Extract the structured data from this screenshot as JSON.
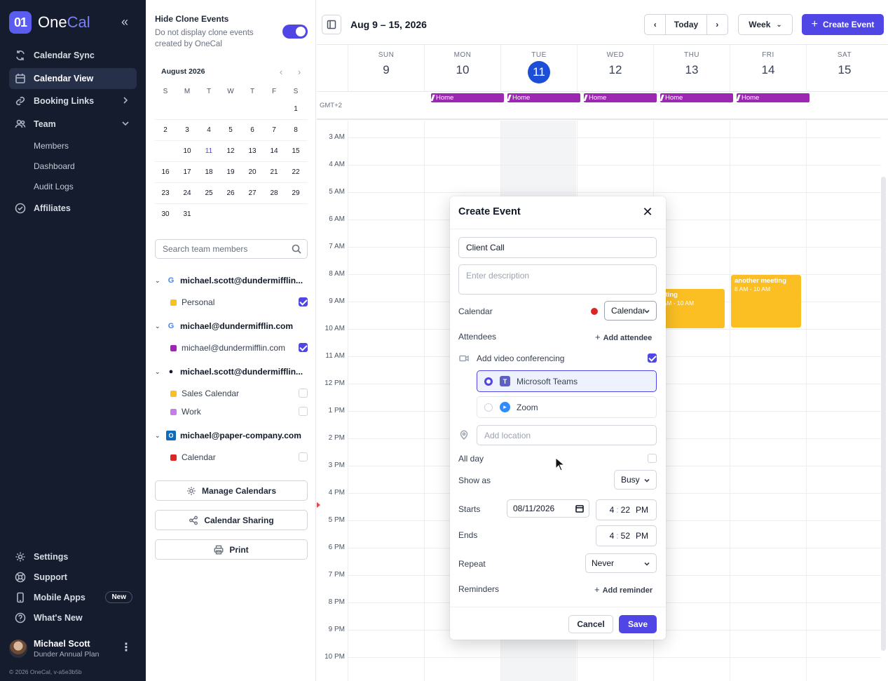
{
  "app": {
    "logo_mark": "01",
    "logo_a": "One",
    "logo_b": "Cal"
  },
  "sidebar": {
    "items": [
      {
        "label": "Calendar Sync",
        "icon": "sync-icon"
      },
      {
        "label": "Calendar View",
        "icon": "calendar-icon",
        "active": true
      },
      {
        "label": "Booking Links",
        "icon": "link-icon"
      },
      {
        "label": "Team",
        "icon": "users-icon"
      },
      {
        "label": "Affiliates",
        "icon": "check-circle-icon"
      }
    ],
    "team_sub": [
      "Members",
      "Dashboard",
      "Audit Logs"
    ],
    "bottom": [
      {
        "label": "Settings",
        "icon": "gear-icon"
      },
      {
        "label": "Support",
        "icon": "support-icon"
      },
      {
        "label": "Mobile Apps",
        "icon": "phone-icon",
        "badge": "New"
      },
      {
        "label": "What's New",
        "icon": "question-icon"
      }
    ],
    "user": {
      "name": "Michael Scott",
      "plan": "Dunder Annual Plan"
    },
    "footer": "© 2026 OneCal, v-a5e3b5b"
  },
  "panel": {
    "clone_title": "Hide Clone Events",
    "clone_desc": "Do not display clone events created by OneCal",
    "mini_cal": {
      "title": "August 2026",
      "dow": [
        "S",
        "M",
        "T",
        "W",
        "T",
        "F",
        "S"
      ],
      "weeks": [
        [
          "",
          "",
          "",
          "",
          "",
          "",
          "1"
        ],
        [
          "2",
          "3",
          "4",
          "5",
          "6",
          "7",
          "8"
        ],
        [
          "9",
          "10",
          "11",
          "12",
          "13",
          "14",
          "15"
        ],
        [
          "16",
          "17",
          "18",
          "19",
          "20",
          "21",
          "22"
        ],
        [
          "23",
          "24",
          "25",
          "26",
          "27",
          "28",
          "29"
        ],
        [
          "30",
          "31",
          "",
          "",
          "",
          "",
          ""
        ]
      ],
      "selected": "9",
      "today": "11"
    },
    "search_placeholder": "Search team members",
    "accounts": [
      {
        "email": "michael.scott@dundermifflin...",
        "provider": "google",
        "calendars": [
          {
            "name": "Personal",
            "color": "#fbbf24",
            "checked": true
          }
        ]
      },
      {
        "email": "michael@dundermifflin.com",
        "provider": "google",
        "calendars": [
          {
            "name": "michael@dundermifflin.com",
            "color": "#9c27b0",
            "checked": true
          }
        ]
      },
      {
        "email": "michael.scott@dundermifflin...",
        "provider": "apple",
        "calendars": [
          {
            "name": "Sales Calendar",
            "color": "#fbbf24",
            "checked": false
          },
          {
            "name": "Work",
            "color": "#c77de8",
            "checked": false
          }
        ]
      },
      {
        "email": "michael@paper-company.com",
        "provider": "outlook",
        "calendars": [
          {
            "name": "Calendar",
            "color": "#dc2626",
            "checked": false
          }
        ]
      }
    ],
    "buttons": {
      "manage": "Manage Calendars",
      "sharing": "Calendar Sharing",
      "print": "Print"
    }
  },
  "header": {
    "range": "Aug 9 – 15, 2026",
    "today": "Today",
    "view": "Week",
    "create": "Create Event",
    "prev": "‹",
    "next": "›"
  },
  "week": {
    "days": [
      {
        "dow": "SUN",
        "num": "9"
      },
      {
        "dow": "MON",
        "num": "10"
      },
      {
        "dow": "TUE",
        "num": "11",
        "today": true
      },
      {
        "dow": "WED",
        "num": "12"
      },
      {
        "dow": "THU",
        "num": "13"
      },
      {
        "dow": "FRI",
        "num": "14"
      },
      {
        "dow": "SAT",
        "num": "15"
      }
    ],
    "timezone": "GMT+2",
    "allday_label": "Home",
    "hours": [
      "3 AM",
      "4 AM",
      "5 AM",
      "6 AM",
      "7 AM",
      "8 AM",
      "9 AM",
      "10 AM",
      "11 AM",
      "12 PM",
      "1 PM",
      "2 PM",
      "3 PM",
      "4 PM",
      "5 PM",
      "6 PM",
      "7 PM",
      "8 PM",
      "9 PM",
      "10 PM"
    ],
    "events": [
      {
        "title": "eeting",
        "time": "0 AM - 10 AM"
      },
      {
        "title": "another meeting",
        "time": "8 AM - 10 AM"
      }
    ]
  },
  "modal": {
    "title": "Create Event",
    "close": "✕",
    "title_value": "Client Call",
    "description_placeholder": "Enter description",
    "calendar_label": "Calendar",
    "calendar_value": "Calendar",
    "calendar_color": "#dc2626",
    "attendees_label": "Attendees",
    "add_attendee": "Add attendee",
    "video_label": "Add video conferencing",
    "video_options": [
      {
        "label": "Microsoft Teams",
        "selected": true
      },
      {
        "label": "Zoom",
        "selected": false
      }
    ],
    "location_placeholder": "Add location",
    "allday_label": "All day",
    "showas_label": "Show as",
    "showas_value": "Busy",
    "starts_label": "Starts",
    "start_date": "08/11/2026",
    "start_time": {
      "h": "4",
      "m": "22",
      "ap": "PM"
    },
    "ends_label": "Ends",
    "end_time": {
      "h": "4",
      "m": "52",
      "ap": "PM"
    },
    "repeat_label": "Repeat",
    "repeat_value": "Never",
    "reminders_label": "Reminders",
    "add_reminder": "Add reminder",
    "cancel": "Cancel",
    "save": "Save",
    "time_sep": ":"
  },
  "colors": {
    "accent": "#4f46e5",
    "sidebar_bg": "#141c2e",
    "home_bar": "#9c27b0",
    "event": "#fbbf24"
  }
}
